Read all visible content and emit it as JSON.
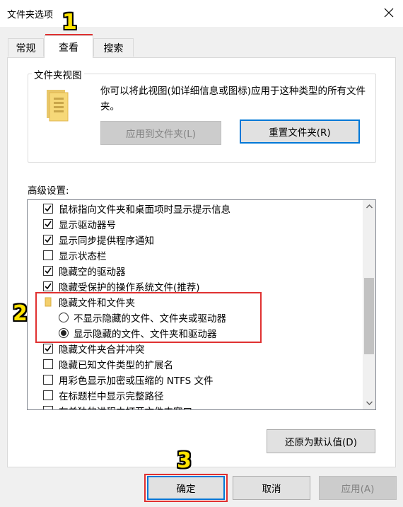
{
  "window": {
    "title": "文件夹选项"
  },
  "tabs": [
    "常规",
    "查看",
    "搜索"
  ],
  "folder_views": {
    "legend": "文件夹视图",
    "description": "你可以将此视图(如详细信息或图标)应用于这种类型的所有文件夹。",
    "apply_button": "应用到文件夹(L)",
    "reset_button": "重置文件夹(R)"
  },
  "advanced": {
    "label": "高级设置:",
    "items": [
      {
        "text": "鼠标指向文件夹和桌面项时显示提示信息",
        "checked": true
      },
      {
        "text": "显示驱动器号",
        "checked": true
      },
      {
        "text": "显示同步提供程序通知",
        "checked": true
      },
      {
        "text": "显示状态栏",
        "checked": false
      },
      {
        "text": "隐藏空的驱动器",
        "checked": true
      },
      {
        "text": "隐藏受保护的操作系统文件(推荐)",
        "checked": true
      },
      {
        "text": "隐藏文件和文件夹",
        "type": "folder"
      },
      {
        "text": "不显示隐藏的文件、文件夹或驱动器",
        "type": "radio",
        "selected": false
      },
      {
        "text": "显示隐藏的文件、文件夹和驱动器",
        "type": "radio",
        "selected": true
      },
      {
        "text": "隐藏文件夹合并冲突",
        "checked": true
      },
      {
        "text": "隐藏已知文件类型的扩展名",
        "checked": false
      },
      {
        "text": "用彩色显示加密或压缩的 NTFS 文件",
        "checked": false
      },
      {
        "text": "在标题栏中显示完整路径",
        "checked": false
      },
      {
        "text": "在单独的进程中打开文件夹窗口",
        "checked": false
      }
    ],
    "restore_button": "还原为默认值(D)"
  },
  "footer": {
    "ok": "确定",
    "cancel": "取消",
    "apply": "应用(A)"
  },
  "annotations": [
    "1",
    "2",
    "3"
  ],
  "colors": {
    "highlight": "#e03131",
    "step_number": "#fde300",
    "focus": "#0078d7"
  }
}
